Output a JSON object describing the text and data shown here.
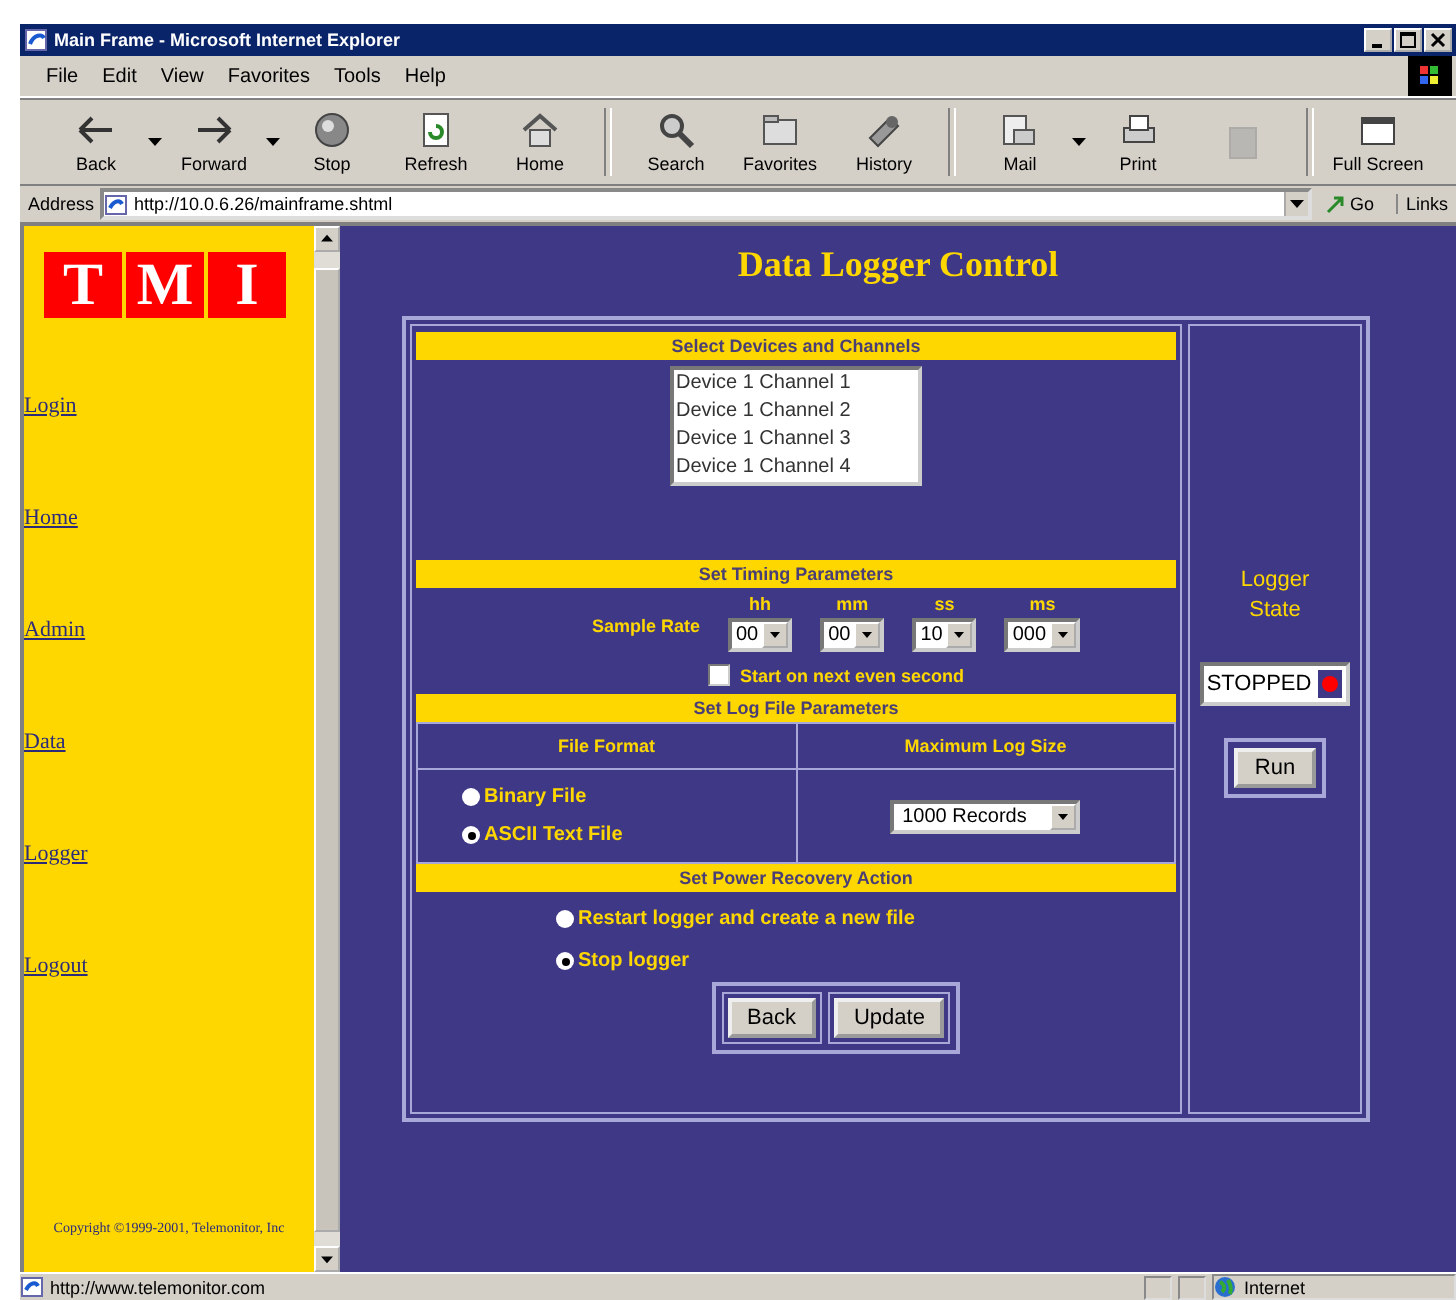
{
  "window": {
    "title": "Main Frame - Microsoft Internet Explorer"
  },
  "menu": [
    "File",
    "Edit",
    "View",
    "Favorites",
    "Tools",
    "Help"
  ],
  "toolbar": {
    "groups": [
      [
        {
          "kind": "back",
          "label": "Back",
          "dropdown": true,
          "disabled": false
        },
        {
          "kind": "forward",
          "label": "Forward",
          "dropdown": true,
          "disabled": false
        },
        {
          "kind": "stop",
          "label": "Stop",
          "dropdown": false,
          "disabled": false
        },
        {
          "kind": "refresh",
          "label": "Refresh",
          "dropdown": false,
          "disabled": false
        },
        {
          "kind": "home",
          "label": "Home",
          "dropdown": false,
          "disabled": false
        }
      ],
      [
        {
          "kind": "search",
          "label": "Search",
          "dropdown": false,
          "disabled": false
        },
        {
          "kind": "favorites",
          "label": "Favorites",
          "dropdown": false,
          "disabled": false
        },
        {
          "kind": "history",
          "label": "History",
          "dropdown": false,
          "disabled": false
        }
      ],
      [
        {
          "kind": "mail",
          "label": "Mail",
          "dropdown": true,
          "disabled": false
        },
        {
          "kind": "print",
          "label": "Print",
          "dropdown": false,
          "disabled": false
        },
        {
          "kind": "edit",
          "dropdown": false,
          "disabled": true
        }
      ],
      [
        {
          "kind": "fullscreen",
          "label": "Full Screen",
          "dropdown": false,
          "disabled": false
        }
      ]
    ]
  },
  "address": {
    "label": "Address",
    "value": "http://10.0.6.26/mainframe.shtml",
    "go": "Go",
    "links": "Links"
  },
  "sidebar": {
    "logo": [
      "T",
      "M",
      "I"
    ],
    "links": [
      "Login",
      "Home",
      "Admin",
      "Data",
      "Logger",
      "Logout"
    ],
    "copyright": "Copyright ©1999-2001, Telemonitor, Inc"
  },
  "main": {
    "title": "Data Logger Control",
    "devices": {
      "heading": "Select Devices and Channels",
      "options": [
        {
          "label": "Device 1 Channel 1",
          "selected": false
        },
        {
          "label": "Device 1 Channel 2",
          "selected": false
        },
        {
          "label": "Device 1 Channel 3",
          "selected": false
        },
        {
          "label": "Device 1 Channel 4",
          "selected": false
        }
      ]
    },
    "timing": {
      "heading": "Set Timing Parameters",
      "label": "Sample Rate",
      "fields": [
        {
          "unit": "hh",
          "value": "00"
        },
        {
          "unit": "mm",
          "value": "00"
        },
        {
          "unit": "ss",
          "value": "10"
        },
        {
          "unit": "ms",
          "value": "000"
        }
      ],
      "start_even_second": {
        "label": "Start on next even second",
        "checked": false
      }
    },
    "log_file": {
      "heading": "Set Log File Parameters",
      "format_heading": "File Format",
      "size_heading": "Maximum Log Size",
      "formats": [
        {
          "label": "Binary File",
          "selected": false
        },
        {
          "label": "ASCII Text File",
          "selected": true
        }
      ],
      "size": "1000 Records"
    },
    "power": {
      "heading": "Set Power Recovery Action",
      "options": [
        {
          "label": "Restart logger and create a new file",
          "selected": false
        },
        {
          "label": "Stop logger",
          "selected": true
        }
      ]
    },
    "buttons": [
      "Back",
      "Update"
    ],
    "state": {
      "title": "Logger State",
      "value": "STOPPED",
      "color": "#ff0000",
      "button": "Run"
    }
  },
  "status_bar": {
    "text": "http://www.telemonitor.com",
    "zone": "Internet"
  }
}
